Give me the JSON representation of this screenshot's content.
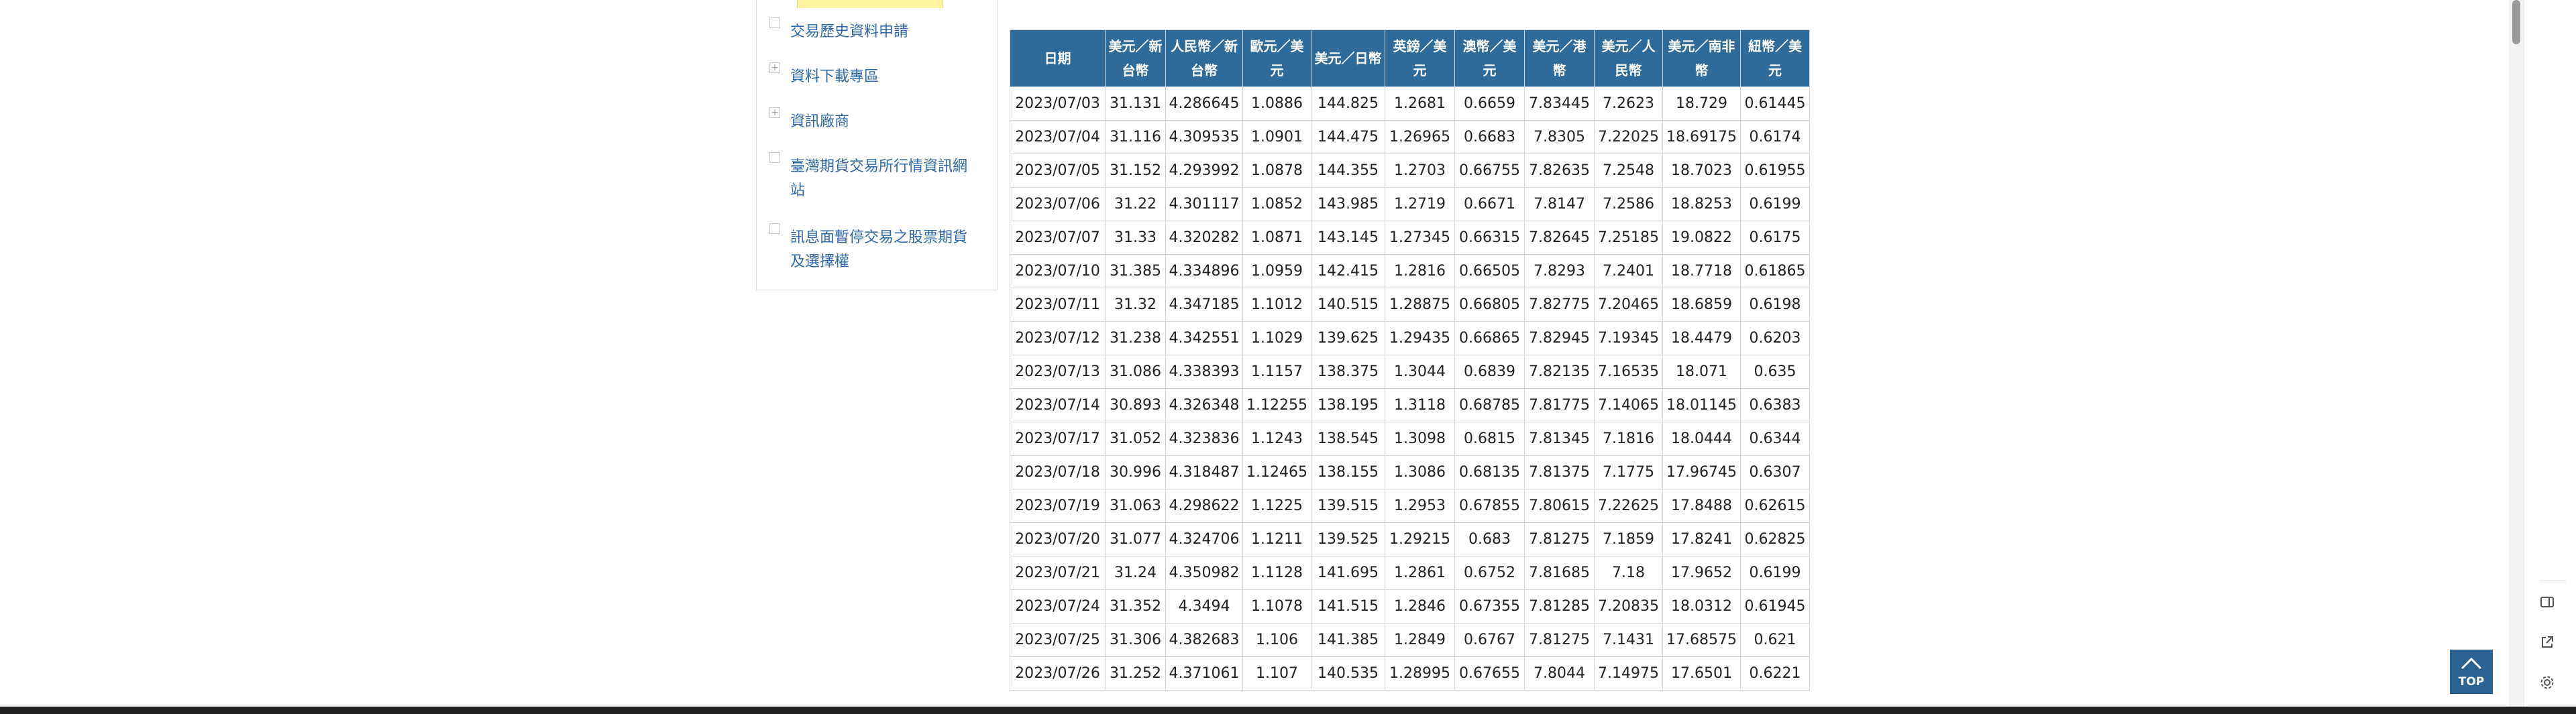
{
  "sidebar": {
    "items": [
      {
        "label": "交易歷史資料申請",
        "icon": "square-bullet-icon"
      },
      {
        "label": "資料下載專區",
        "icon": "plus-expand-icon"
      },
      {
        "label": "資訊廠商",
        "icon": "plus-expand-icon"
      },
      {
        "label": "臺灣期貨交易所行情資訊網站",
        "icon": "square-bullet-icon"
      },
      {
        "label": "訊息面暫停交易之股票期貨及選擇權",
        "icon": "square-bullet-icon"
      }
    ]
  },
  "table": {
    "headers": [
      "日期",
      "美元／新台幣",
      "人民幣／新台幣",
      "歐元／美元",
      "美元／日幣",
      "英鎊／美元",
      "澳幣／美元",
      "美元／港幣",
      "美元／人民幣",
      "美元／南非幣",
      "紐幣／美元"
    ],
    "rows": [
      [
        "2023/07/03",
        "31.131",
        "4.286645",
        "1.0886",
        "144.825",
        "1.2681",
        "0.6659",
        "7.83445",
        "7.2623",
        "18.729",
        "0.61445"
      ],
      [
        "2023/07/04",
        "31.116",
        "4.309535",
        "1.0901",
        "144.475",
        "1.26965",
        "0.6683",
        "7.8305",
        "7.22025",
        "18.69175",
        "0.6174"
      ],
      [
        "2023/07/05",
        "31.152",
        "4.293992",
        "1.0878",
        "144.355",
        "1.2703",
        "0.66755",
        "7.82635",
        "7.2548",
        "18.7023",
        "0.61955"
      ],
      [
        "2023/07/06",
        "31.22",
        "4.301117",
        "1.0852",
        "143.985",
        "1.2719",
        "0.6671",
        "7.8147",
        "7.2586",
        "18.8253",
        "0.6199"
      ],
      [
        "2023/07/07",
        "31.33",
        "4.320282",
        "1.0871",
        "143.145",
        "1.27345",
        "0.66315",
        "7.82645",
        "7.25185",
        "19.0822",
        "0.6175"
      ],
      [
        "2023/07/10",
        "31.385",
        "4.334896",
        "1.0959",
        "142.415",
        "1.2816",
        "0.66505",
        "7.8293",
        "7.2401",
        "18.7718",
        "0.61865"
      ],
      [
        "2023/07/11",
        "31.32",
        "4.347185",
        "1.1012",
        "140.515",
        "1.28875",
        "0.66805",
        "7.82775",
        "7.20465",
        "18.6859",
        "0.6198"
      ],
      [
        "2023/07/12",
        "31.238",
        "4.342551",
        "1.1029",
        "139.625",
        "1.29435",
        "0.66865",
        "7.82945",
        "7.19345",
        "18.4479",
        "0.6203"
      ],
      [
        "2023/07/13",
        "31.086",
        "4.338393",
        "1.1157",
        "138.375",
        "1.3044",
        "0.6839",
        "7.82135",
        "7.16535",
        "18.071",
        "0.635"
      ],
      [
        "2023/07/14",
        "30.893",
        "4.326348",
        "1.12255",
        "138.195",
        "1.3118",
        "0.68785",
        "7.81775",
        "7.14065",
        "18.01145",
        "0.6383"
      ],
      [
        "2023/07/17",
        "31.052",
        "4.323836",
        "1.1243",
        "138.545",
        "1.3098",
        "0.6815",
        "7.81345",
        "7.1816",
        "18.0444",
        "0.6344"
      ],
      [
        "2023/07/18",
        "30.996",
        "4.318487",
        "1.12465",
        "138.155",
        "1.3086",
        "0.68135",
        "7.81375",
        "7.1775",
        "17.96745",
        "0.6307"
      ],
      [
        "2023/07/19",
        "31.063",
        "4.298622",
        "1.1225",
        "139.515",
        "1.2953",
        "0.67855",
        "7.80615",
        "7.22625",
        "17.8488",
        "0.62615"
      ],
      [
        "2023/07/20",
        "31.077",
        "4.324706",
        "1.1211",
        "139.525",
        "1.29215",
        "0.683",
        "7.81275",
        "7.1859",
        "17.8241",
        "0.62825"
      ],
      [
        "2023/07/21",
        "31.24",
        "4.350982",
        "1.1128",
        "141.695",
        "1.2861",
        "0.6752",
        "7.81685",
        "7.18",
        "17.9652",
        "0.6199"
      ],
      [
        "2023/07/24",
        "31.352",
        "4.3494",
        "1.1078",
        "141.515",
        "1.2846",
        "0.67355",
        "7.81285",
        "7.20835",
        "18.0312",
        "0.61945"
      ],
      [
        "2023/07/25",
        "31.306",
        "4.382683",
        "1.106",
        "141.385",
        "1.2849",
        "0.6767",
        "7.81275",
        "7.1431",
        "17.68575",
        "0.621"
      ],
      [
        "2023/07/26",
        "31.252",
        "4.371061",
        "1.107",
        "140.535",
        "1.28995",
        "0.67655",
        "7.8044",
        "7.14975",
        "17.6501",
        "0.6221"
      ]
    ]
  },
  "back_to_top": {
    "label": "TOP"
  },
  "colors": {
    "header_bg": "#2f6b9a",
    "link": "#3068a8",
    "top_button": "#2a6291"
  }
}
